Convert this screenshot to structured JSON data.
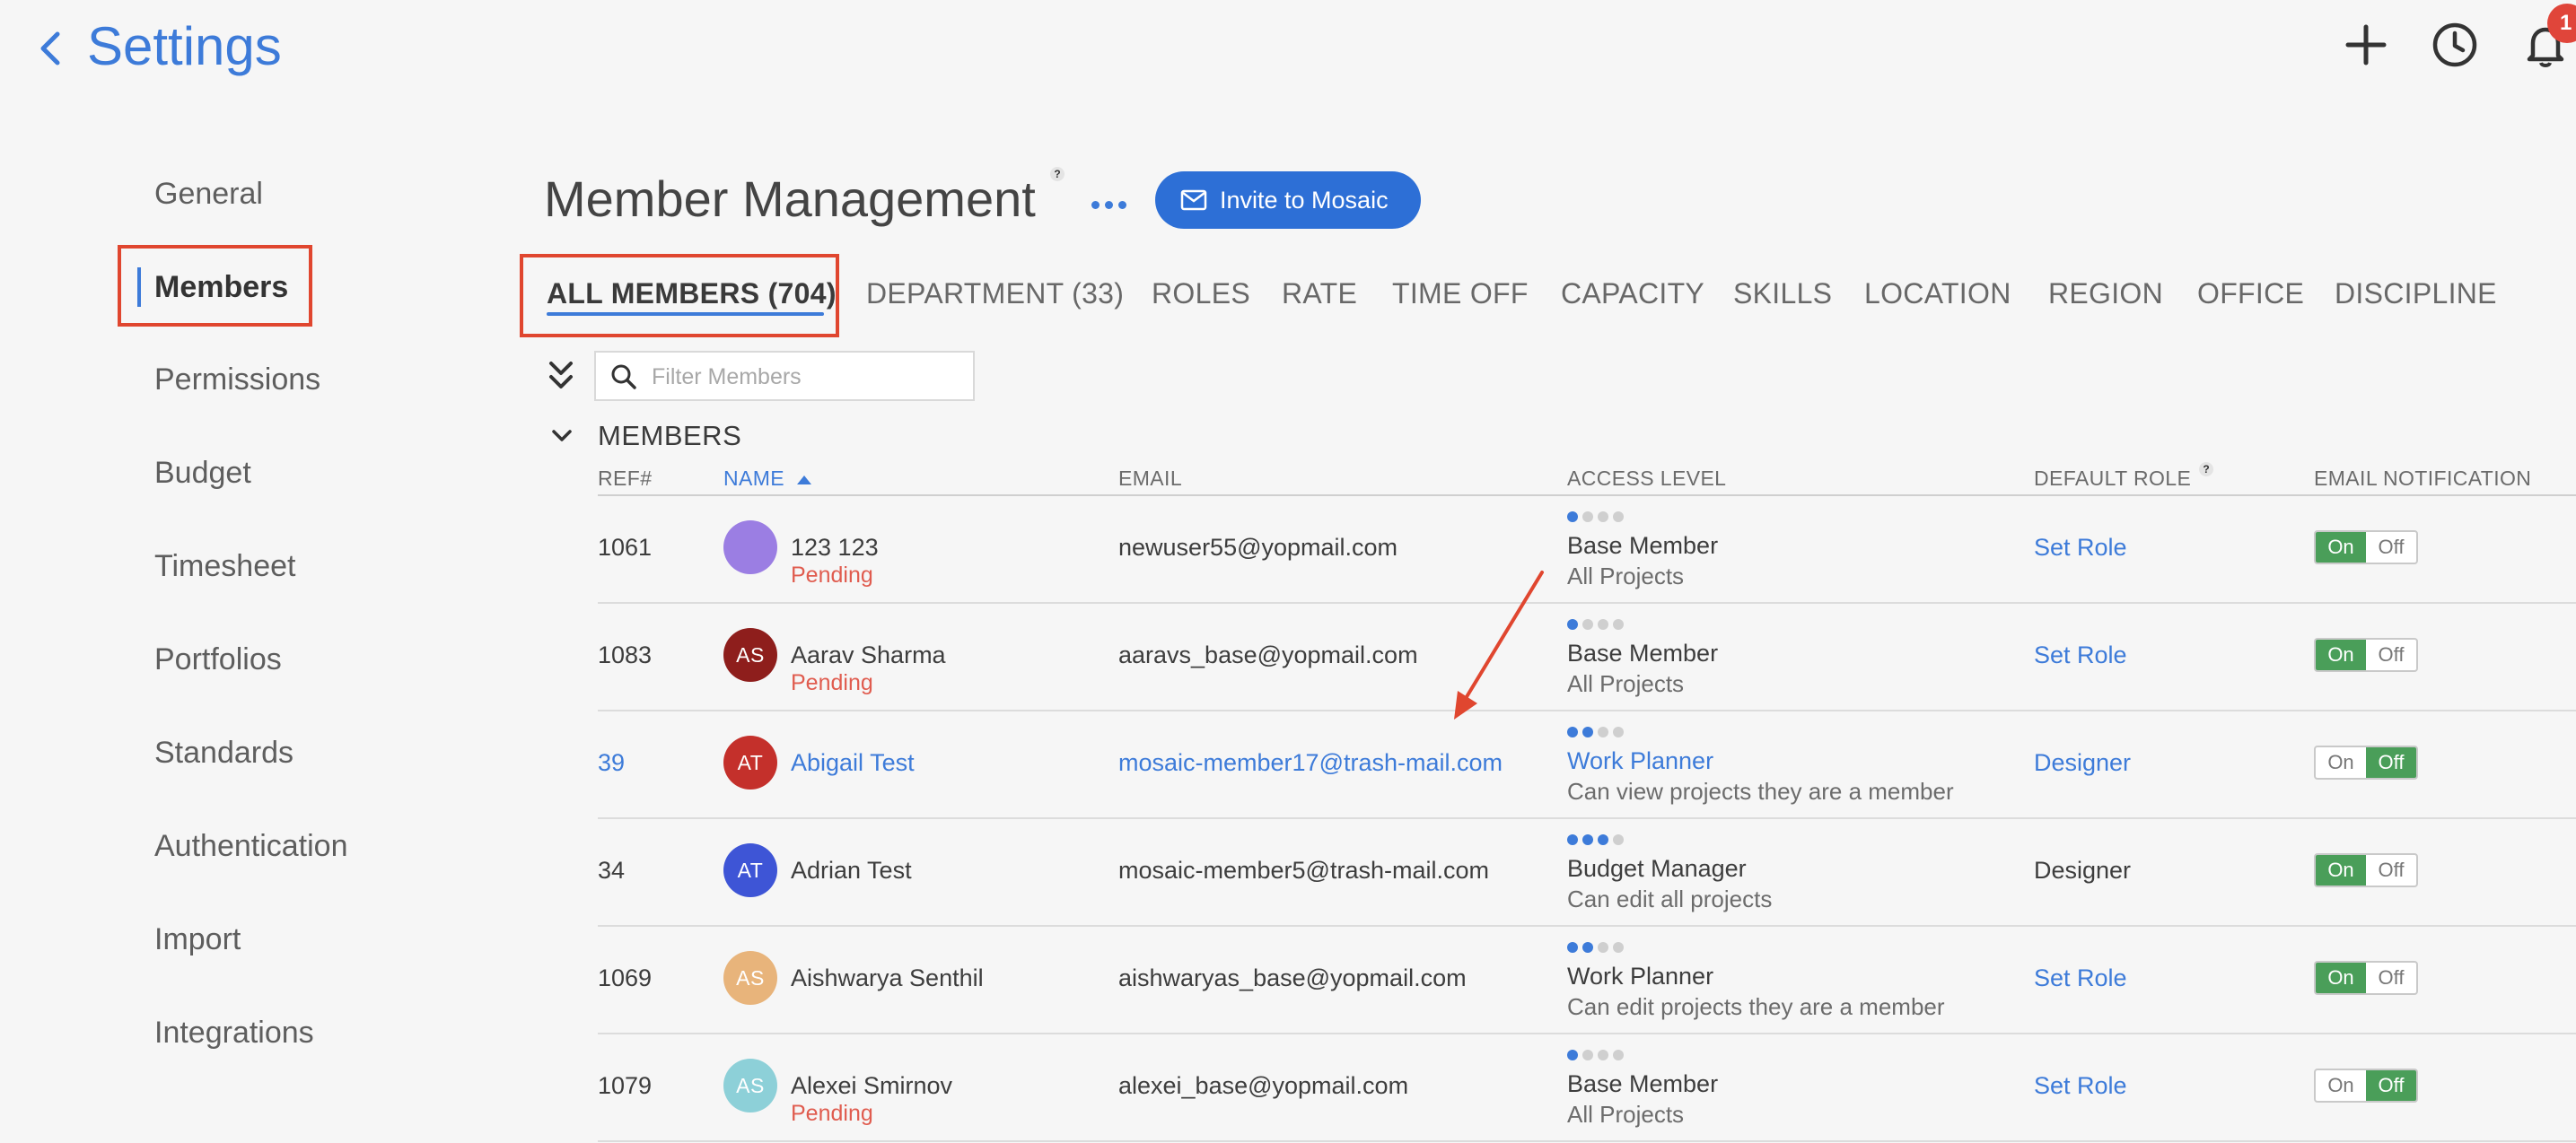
{
  "header": {
    "title": "Settings",
    "notification_count": "1"
  },
  "sidebar": {
    "items": [
      {
        "label": "General"
      },
      {
        "label": "Members"
      },
      {
        "label": "Permissions"
      },
      {
        "label": "Budget"
      },
      {
        "label": "Timesheet"
      },
      {
        "label": "Portfolios"
      },
      {
        "label": "Standards"
      },
      {
        "label": "Authentication"
      },
      {
        "label": "Import"
      },
      {
        "label": "Integrations"
      }
    ],
    "active": "Members"
  },
  "page": {
    "title": "Member Management",
    "help": "?",
    "invite_label": "Invite to Mosaic"
  },
  "tabs": [
    {
      "label": "ALL MEMBERS (704)"
    },
    {
      "label": "DEPARTMENT (33)"
    },
    {
      "label": "ROLES"
    },
    {
      "label": "RATE"
    },
    {
      "label": "TIME OFF"
    },
    {
      "label": "CAPACITY"
    },
    {
      "label": "SKILLS"
    },
    {
      "label": "LOCATION"
    },
    {
      "label": "REGION"
    },
    {
      "label": "OFFICE"
    },
    {
      "label": "DISCIPLINE"
    }
  ],
  "filter": {
    "placeholder": "Filter Members",
    "value": ""
  },
  "section": {
    "title": "MEMBERS"
  },
  "table": {
    "columns": {
      "ref": "REF#",
      "name": "NAME",
      "email": "EMAIL",
      "access": "ACCESS LEVEL",
      "role": "DEFAULT ROLE",
      "role_help": "?",
      "notification": "EMAIL NOTIFICATION"
    },
    "sort": {
      "column": "NAME",
      "direction": "ascending"
    },
    "toggle_on_label": "On",
    "toggle_off_label": "Off",
    "rows": [
      {
        "ref": "1061",
        "initials": "",
        "avatar_color": "#9b7ee3",
        "name": "123 123",
        "status": "Pending",
        "email": "newuser55@yopmail.com",
        "access_level": 1,
        "access": "Base Member",
        "access_sub": "All Projects",
        "role": "Set Role",
        "notification": "On"
      },
      {
        "ref": "1083",
        "initials": "AS",
        "avatar_color": "#8e1e1c",
        "name": "Aarav Sharma",
        "status": "Pending",
        "email": "aaravs_base@yopmail.com",
        "access_level": 1,
        "access": "Base Member",
        "access_sub": "All Projects",
        "role": "Set Role",
        "notification": "On"
      },
      {
        "ref": "39",
        "initials": "AT",
        "avatar_color": "#c4302b",
        "name": "Abigail Test",
        "status": "",
        "email": "mosaic-member17@trash-mail.com",
        "access_level": 2,
        "access": "Work Planner",
        "access_sub": "Can view projects they are a member",
        "role": "Designer",
        "notification": "Off"
      },
      {
        "ref": "34",
        "initials": "AT",
        "avatar_color": "#3e55d6",
        "name": "Adrian Test",
        "status": "",
        "email": "mosaic-member5@trash-mail.com",
        "access_level": 3,
        "access": "Budget Manager",
        "access_sub": "Can edit all projects",
        "role": "Designer",
        "notification": "On"
      },
      {
        "ref": "1069",
        "initials": "AS",
        "avatar_color": "#e8b47b",
        "name": "Aishwarya Senthil",
        "status": "",
        "email": "aishwaryas_base@yopmail.com",
        "access_level": 2,
        "access": "Work Planner",
        "access_sub": "Can edit projects they are a member",
        "role": "Set Role",
        "notification": "On"
      },
      {
        "ref": "1079",
        "initials": "AS",
        "avatar_color": "#8dd0d8",
        "name": "Alexei Smirnov",
        "status": "Pending",
        "email": "alexei_base@yopmail.com",
        "access_level": 1,
        "access": "Base Member",
        "access_sub": "All Projects",
        "role": "Set Role",
        "notification": "Off"
      }
    ]
  },
  "colors": {
    "accent": "#3d7bd9",
    "annotation": "#e0462f",
    "toggle_on": "#4a9e59",
    "pending": "#e05c4f"
  }
}
